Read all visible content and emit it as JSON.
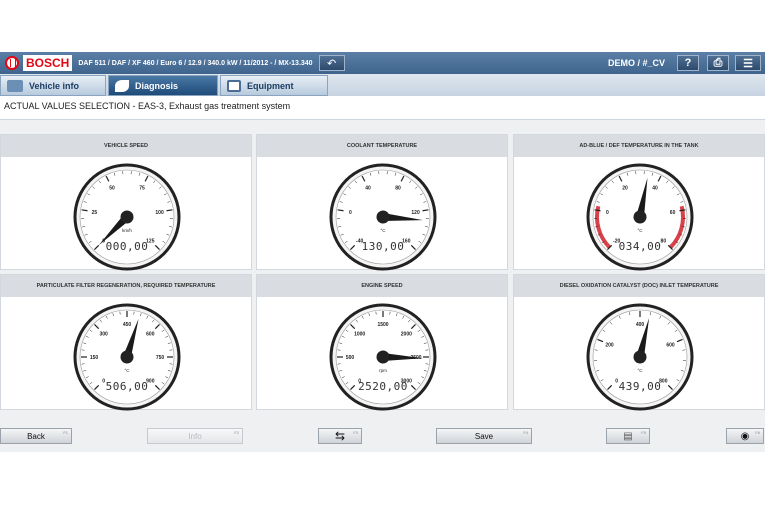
{
  "header": {
    "brand": "BOSCH",
    "vehicle_path": "DAF 511 / DAF / XF 460 / Euro 6 / 12.9 / 340.0 kW / 11/2012 - / MX-13.340",
    "user": "DEMO / #_CV",
    "icons": [
      "undo-icon",
      "help-icon",
      "print-icon",
      "menu-icon"
    ],
    "help_label": "?"
  },
  "tabs": [
    {
      "label": "Vehicle info",
      "active": false
    },
    {
      "label": "Diagnosis",
      "active": true
    },
    {
      "label": "Equipment",
      "active": false
    }
  ],
  "subtitle": "ACTUAL VALUES SELECTION - EAS-3, Exhaust gas treatment system",
  "gauges": [
    {
      "title": "VEHICLE SPEED",
      "unit": "km/h",
      "ticks": [
        "0",
        "25",
        "50",
        "75",
        "100",
        "125"
      ],
      "readout": "000,00",
      "value": 0,
      "min": 0,
      "max": 125,
      "hot_zone": false
    },
    {
      "title": "COOLANT TEMPERATURE",
      "unit": "°C",
      "ticks": [
        "-40",
        "0",
        "40",
        "80",
        "120",
        "160"
      ],
      "readout": "130,00",
      "value": 130,
      "min": -40,
      "max": 160,
      "hot_zone": false
    },
    {
      "title": "AD-BLUE / DEF TEMPERATURE IN THE TANK",
      "unit": "°C",
      "ticks": [
        "-20",
        "0",
        "20",
        "40",
        "60",
        "80"
      ],
      "readout": "034,00",
      "value": 34,
      "min": -20,
      "max": 80,
      "hot_zone": true
    },
    {
      "title": "PARTICULATE FILTER REGENERATION, REQUIRED TEMPERATURE",
      "unit": "°C",
      "ticks": [
        "0",
        "150",
        "300",
        "450",
        "600",
        "750",
        "900"
      ],
      "readout": "506,00",
      "value": 506,
      "min": 0,
      "max": 900,
      "hot_zone": false
    },
    {
      "title": "ENGINE SPEED",
      "unit": "rpm",
      "ticks": [
        "0",
        "500",
        "1000",
        "1500",
        "2000",
        "2500",
        "3000"
      ],
      "readout": "2520,00",
      "value": 2520,
      "min": 0,
      "max": 3000,
      "hot_zone": false
    },
    {
      "title": "DIESEL OXIDATION CATALYST (DOC) INLET TEMPERATURE",
      "unit": "°C",
      "ticks": [
        "0",
        "200",
        "400",
        "600",
        "800"
      ],
      "readout": "439,00",
      "value": 439,
      "min": 0,
      "max": 800,
      "hot_zone": false
    }
  ],
  "footer": {
    "back": {
      "label": "Back",
      "fkey": "F1"
    },
    "info": {
      "label": "Info",
      "fkey": "F2"
    },
    "switch": {
      "icon": "swap-arrows-icon",
      "fkey": "F3"
    },
    "save": {
      "label": "Save",
      "fkey": "F4"
    },
    "chart": {
      "icon": "chart-icon",
      "fkey": "F5"
    },
    "record": {
      "icon": "record-icon",
      "fkey": "F6"
    }
  },
  "colors": {
    "header": "#3f648d",
    "accent_red": "#e30613",
    "hot_zone": "#d9404a"
  }
}
